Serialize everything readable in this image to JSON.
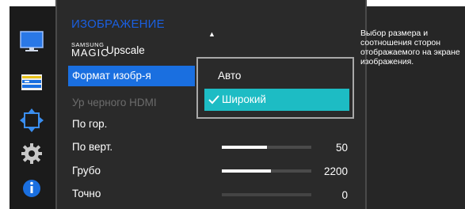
{
  "menu": {
    "title": "ИЗОБРАЖЕНИЕ",
    "magic_upscale": {
      "brand_small": "SAMSUNG",
      "brand_big": "MAGIC",
      "label": "Upscale"
    },
    "items": [
      {
        "label": "Формат изобр-я",
        "state": "selected"
      },
      {
        "label": "Ур черного HDMI",
        "state": "disabled"
      },
      {
        "label": "По гор.",
        "state": "normal"
      },
      {
        "label": "По верт.",
        "state": "normal",
        "value": "50",
        "level": 0.5
      },
      {
        "label": "Грубо",
        "state": "normal",
        "value": "2200",
        "level": 0.55
      },
      {
        "label": "Точно",
        "state": "normal",
        "value": "0",
        "level": 0.0
      }
    ]
  },
  "submenu": {
    "options": [
      {
        "label": "Авто",
        "selected": false
      },
      {
        "label": "Широкий",
        "selected": true
      }
    ]
  },
  "help": {
    "text": "Выбор размера и соотношения сторон отображаемого на экране изображения."
  },
  "icons": [
    "monitor-icon",
    "color-bars-icon",
    "resize-arrows-icon",
    "gear-icon",
    "info-icon"
  ],
  "colors": {
    "title": "#1a5fe0",
    "selected_item": "#1a6fe0",
    "selected_option": "#1dbcc4",
    "background": "#2a2a2a"
  }
}
